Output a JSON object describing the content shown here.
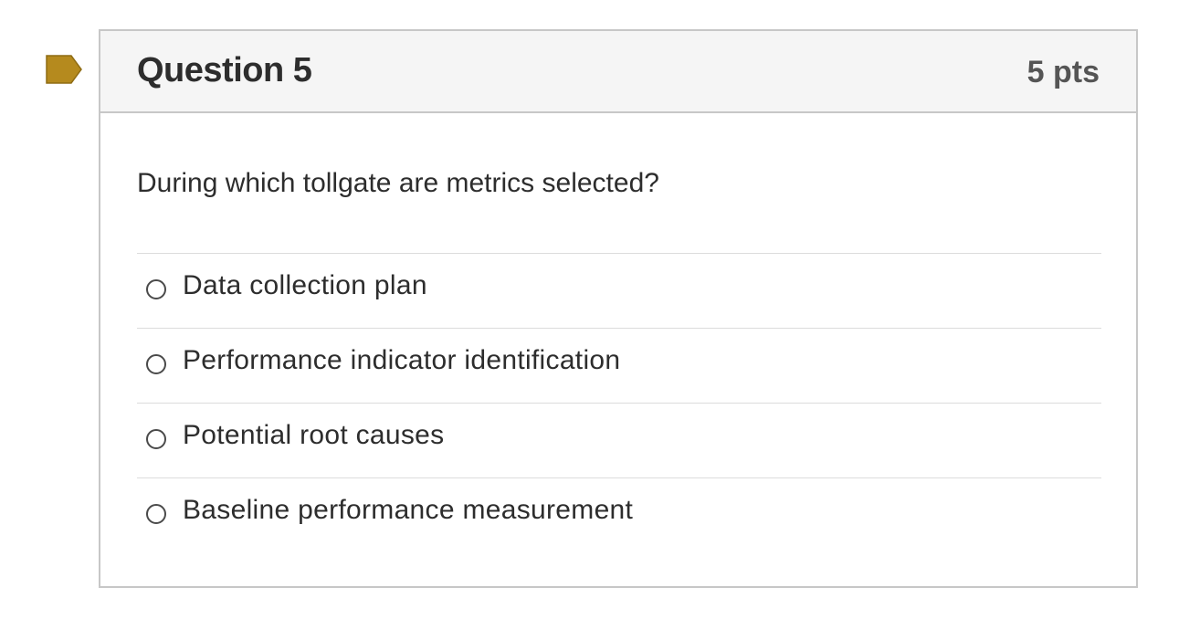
{
  "question": {
    "title": "Question 5",
    "points": "5 pts",
    "text": "During which tollgate are metrics selected?",
    "flag_color": "#b58a1e",
    "answers": [
      {
        "label": "Data collection plan",
        "selected": false
      },
      {
        "label": "Performance indicator identification",
        "selected": false
      },
      {
        "label": "Potential root causes",
        "selected": false
      },
      {
        "label": "Baseline performance measurement",
        "selected": false
      }
    ]
  }
}
